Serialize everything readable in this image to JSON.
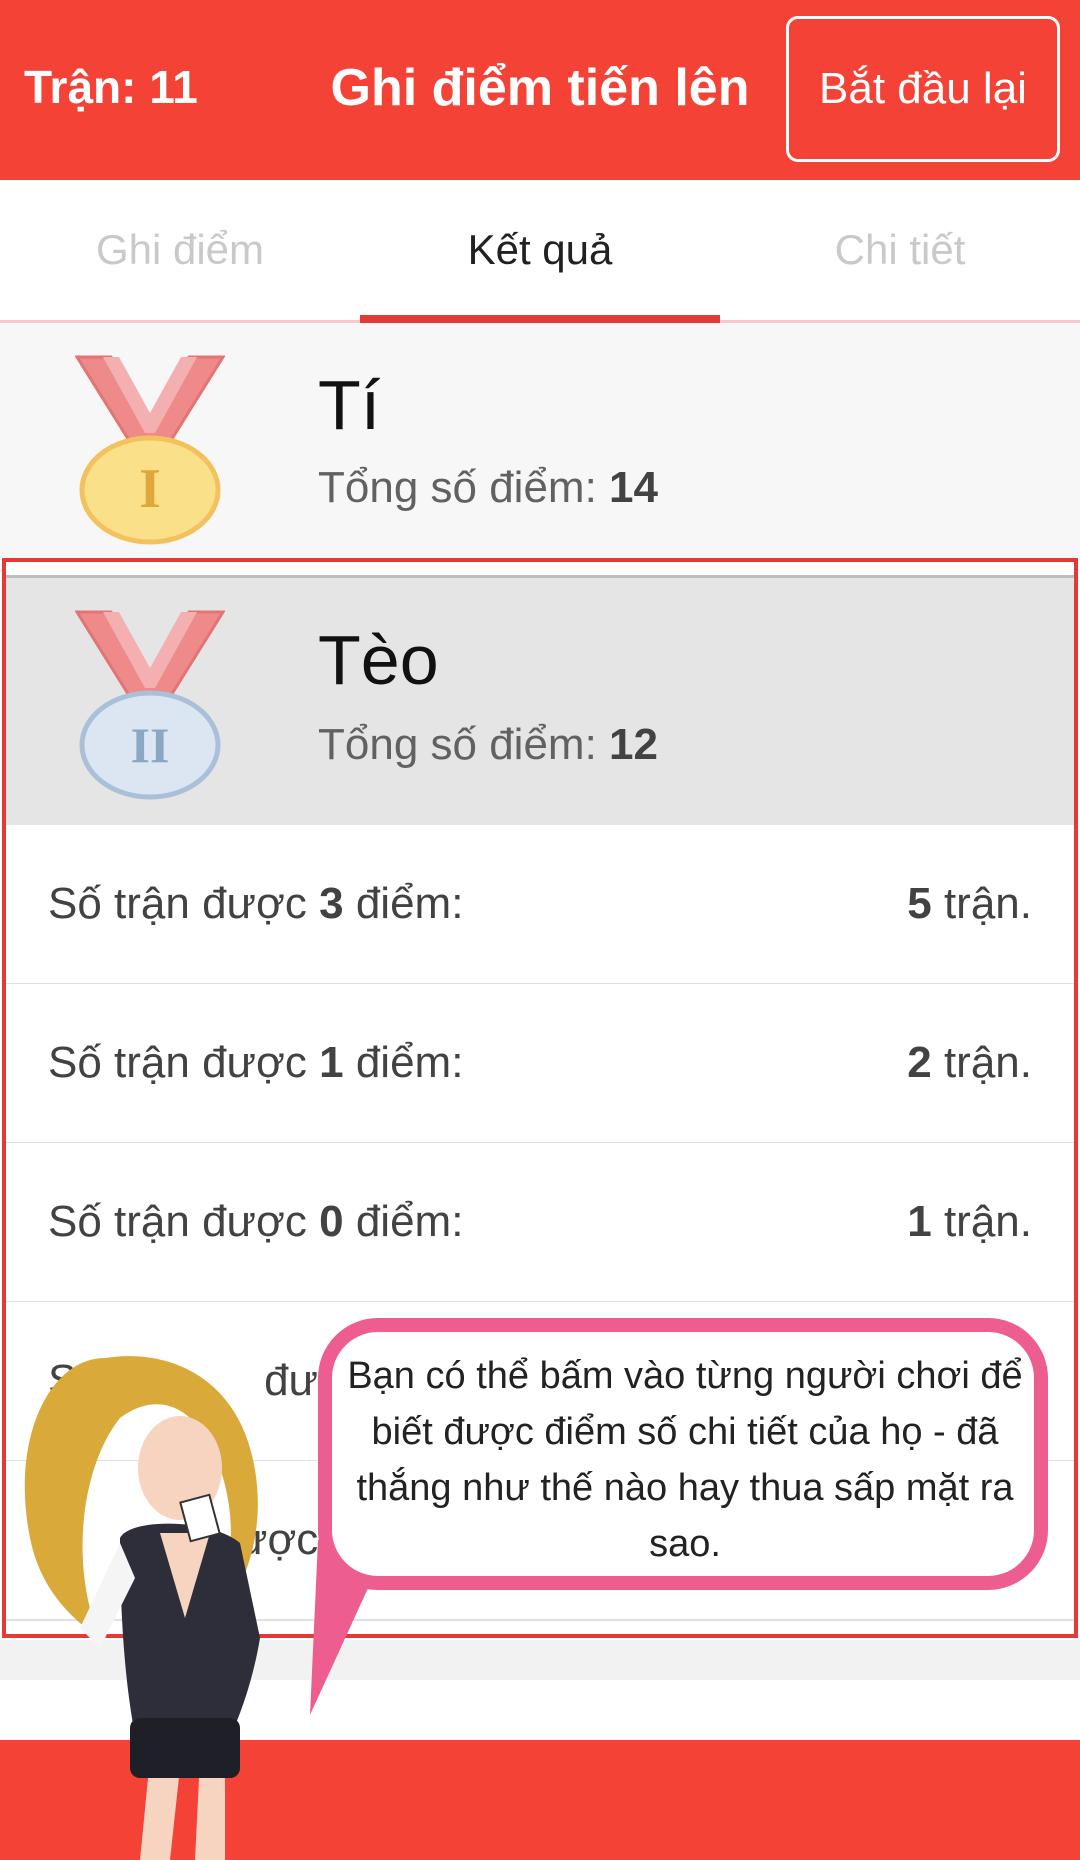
{
  "header": {
    "match_label": "Trận: 11",
    "title": "Ghi điểm tiến lên",
    "restart_label": "Bắt đầu lại"
  },
  "tabs": [
    {
      "label": "Ghi điểm",
      "active": false
    },
    {
      "label": "Kết quả",
      "active": true
    },
    {
      "label": "Chi tiết",
      "active": false
    }
  ],
  "players": [
    {
      "name": "Tí",
      "total_label": "Tổng số điểm:",
      "total": "14",
      "medal": "gold-medal-icon",
      "rank_mark": "I"
    },
    {
      "name": "Tèo",
      "total_label": "Tổng số điểm:",
      "total": "12",
      "medal": "silver-medal-icon",
      "rank_mark": "II"
    }
  ],
  "stats": [
    {
      "prefix": "Số trận được",
      "points": "3",
      "suffix": "điểm:",
      "count": "5",
      "unit": "trận."
    },
    {
      "prefix": "Số trận được",
      "points": "1",
      "suffix": "điểm:",
      "count": "2",
      "unit": "trận."
    },
    {
      "prefix": "Số trận được",
      "points": "0",
      "suffix": "điểm:",
      "count": "1",
      "unit": "trận."
    },
    {
      "prefix": "Số",
      "points": "",
      "suffix": "được",
      "count": "",
      "unit": ""
    },
    {
      "prefix": "",
      "points": "",
      "suffix": "ược",
      "count": "",
      "unit": ""
    }
  ],
  "tooltip": {
    "text": "Bạn có thể bấm vào từng người chơi để biết được điểm số chi tiết của họ - đã thắng như thế nào hay thua sấp mặt ra sao."
  },
  "colors": {
    "primary": "#f44336",
    "bubble_border": "#ee5d8f"
  }
}
